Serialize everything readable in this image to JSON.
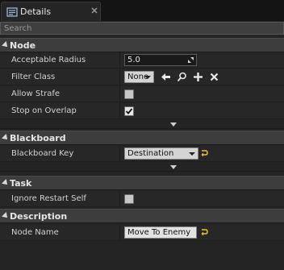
{
  "tab": {
    "title": "Details",
    "icon": "details-icon"
  },
  "search": {
    "placeholder": "Search"
  },
  "categories": {
    "node": {
      "label": "Node",
      "acceptable_radius": {
        "label": "Acceptable Radius",
        "value": "5.0"
      },
      "filter_class": {
        "label": "Filter Class",
        "value": "None"
      },
      "allow_strafe": {
        "label": "Allow Strafe",
        "checked": false
      },
      "stop_on_overlap": {
        "label": "Stop on Overlap",
        "checked": true
      }
    },
    "blackboard": {
      "label": "Blackboard",
      "blackboard_key": {
        "label": "Blackboard Key",
        "value": "Destination"
      }
    },
    "task": {
      "label": "Task",
      "ignore_restart_self": {
        "label": "Ignore Restart Self",
        "checked": false
      }
    },
    "description": {
      "label": "Description",
      "node_name": {
        "label": "Node Name",
        "value": "Move To Enemy"
      }
    }
  },
  "colors": {
    "panel_bg": "#242424",
    "category_bg": "#3d3d3d",
    "reset_arrow": "#e6c33a"
  }
}
